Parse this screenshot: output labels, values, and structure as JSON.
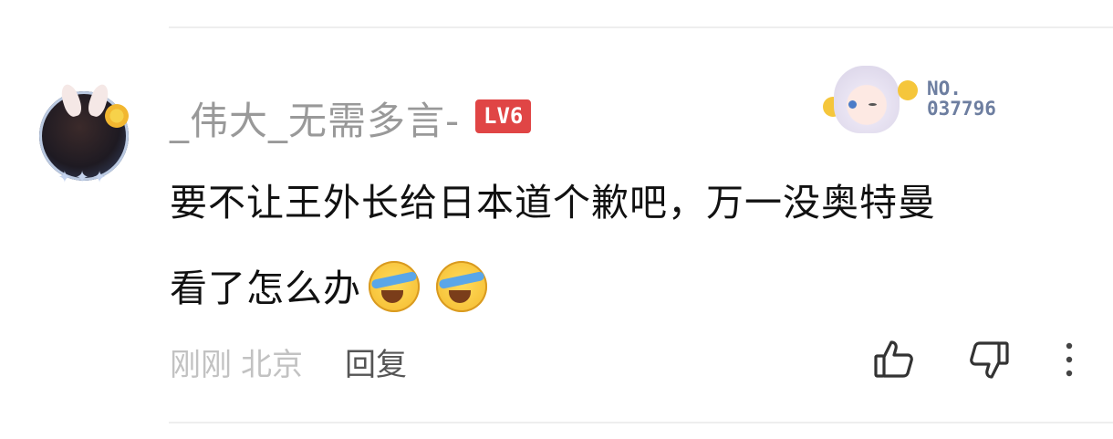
{
  "comment": {
    "username": "_伟大_无需多言-",
    "level_badge": "LV6",
    "fan_badge": {
      "no_label": "NO.",
      "no_number": "037796"
    },
    "text_line1": "要不让王外长给日本道个歉吧，万一没奥特曼",
    "text_line2": "看了怎么办",
    "emojis": [
      "laughing-crying-emoji",
      "laughing-crying-emoji"
    ],
    "time": "刚刚",
    "location": "北京",
    "reply_label": "回复"
  },
  "icons": {
    "like": "thumbs-up-icon",
    "dislike": "thumbs-down-icon",
    "more": "more-vertical-icon"
  },
  "colors": {
    "level_badge": "#e04545",
    "username": "#999999",
    "meta": "#c2c2c2",
    "fan_number": "#6d7ea0"
  }
}
